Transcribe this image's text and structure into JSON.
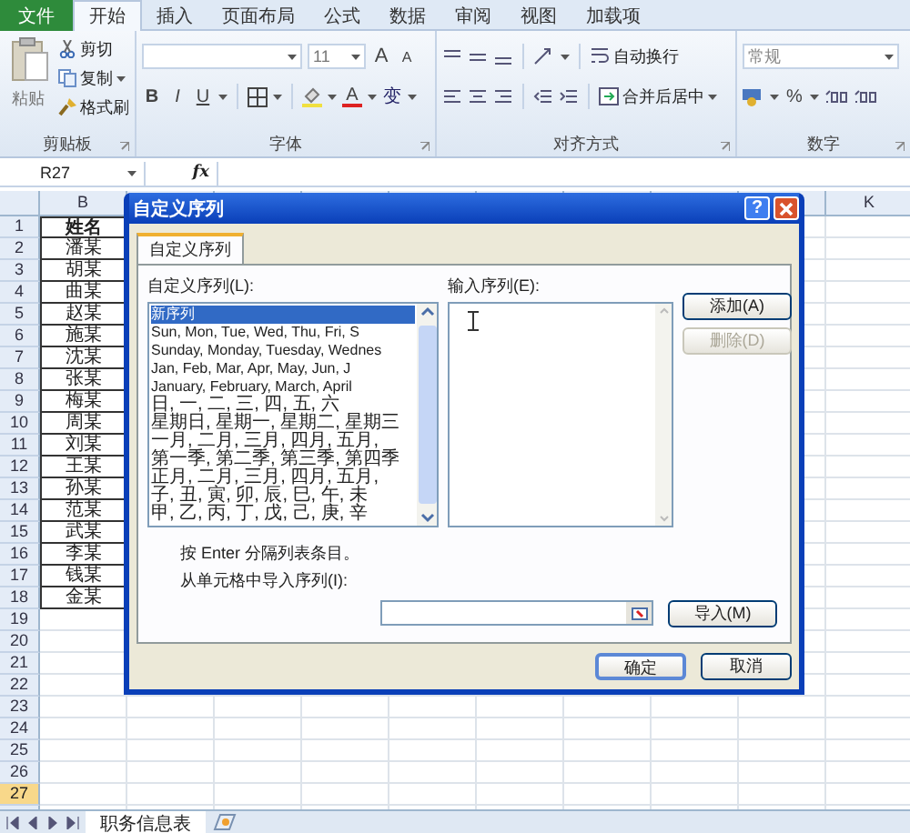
{
  "ribbon": {
    "tabs": [
      {
        "label": "文件",
        "kind": "file",
        "selected": false
      },
      {
        "label": "开始",
        "kind": "tab",
        "selected": true
      },
      {
        "label": "插入",
        "kind": "tab",
        "selected": false
      },
      {
        "label": "页面布局",
        "kind": "tab",
        "selected": false
      },
      {
        "label": "公式",
        "kind": "tab",
        "selected": false
      },
      {
        "label": "数据",
        "kind": "tab",
        "selected": false
      },
      {
        "label": "审阅",
        "kind": "tab",
        "selected": false
      },
      {
        "label": "视图",
        "kind": "tab",
        "selected": false
      },
      {
        "label": "加载项",
        "kind": "tab",
        "selected": false
      }
    ],
    "clipboard": {
      "label": "剪贴板",
      "paste": "粘贴",
      "cut": "剪切",
      "copy": "复制",
      "format_painter": "格式刷"
    },
    "font": {
      "label": "字体",
      "size": "11",
      "size_buttons": [
        "A",
        "A"
      ],
      "style_buttons": [
        "B",
        "I",
        "U"
      ],
      "color_button": "A",
      "phonetic_button": "变"
    },
    "alignment": {
      "label": "对齐方式",
      "wrap": "自动换行",
      "merge": "合并后居中"
    },
    "number": {
      "label": "数字",
      "format": "常规",
      "percent": "%"
    }
  },
  "formula_bar": {
    "name_box": "R27",
    "function_button": "fx"
  },
  "sheet": {
    "columns": [
      "B",
      "K"
    ],
    "rows": [
      {
        "number": "1",
        "name": "姓名",
        "selected": false
      },
      {
        "number": "2",
        "name": "潘某",
        "selected": false
      },
      {
        "number": "3",
        "name": "胡某",
        "selected": false
      },
      {
        "number": "4",
        "name": "曲某",
        "selected": false
      },
      {
        "number": "5",
        "name": "赵某",
        "selected": false
      },
      {
        "number": "6",
        "name": "施某",
        "selected": false
      },
      {
        "number": "7",
        "name": "沈某",
        "selected": false
      },
      {
        "number": "8",
        "name": "张某",
        "selected": false
      },
      {
        "number": "9",
        "name": "梅某",
        "selected": false
      },
      {
        "number": "10",
        "name": "周某",
        "selected": false
      },
      {
        "number": "11",
        "name": "刘某",
        "selected": false
      },
      {
        "number": "12",
        "name": "王某",
        "selected": false
      },
      {
        "number": "13",
        "name": "孙某",
        "selected": false
      },
      {
        "number": "14",
        "name": "范某",
        "selected": false
      },
      {
        "number": "15",
        "name": "武某",
        "selected": false
      },
      {
        "number": "16",
        "name": "李某",
        "selected": false
      },
      {
        "number": "17",
        "name": "钱某",
        "selected": false
      },
      {
        "number": "18",
        "name": "金某",
        "selected": false
      },
      {
        "number": "19",
        "selected": false
      },
      {
        "number": "20",
        "selected": false
      },
      {
        "number": "21",
        "selected": false
      },
      {
        "number": "22",
        "selected": false
      },
      {
        "number": "23",
        "selected": false
      },
      {
        "number": "24",
        "selected": false
      },
      {
        "number": "25",
        "selected": false
      },
      {
        "number": "26",
        "selected": false
      },
      {
        "number": "27",
        "selected": true
      }
    ]
  },
  "sheet_tabs": [
    {
      "label": "职务信息表",
      "selected": true
    }
  ],
  "dialog": {
    "title": "自定义序列",
    "help_button": "?",
    "tabs": [
      {
        "label": "自定义序列",
        "selected": true
      }
    ],
    "list_label": "自定义序列(L):",
    "list_items": [
      {
        "text": "新序列",
        "selected": true
      },
      {
        "text": "Sun, Mon, Tue, Wed, Thu, Fri, S",
        "selected": false
      },
      {
        "text": "Sunday, Monday, Tuesday, Wednes",
        "selected": false
      },
      {
        "text": "Jan, Feb, Mar, Apr, May, Jun, J",
        "selected": false
      },
      {
        "text": "January, February, March, April",
        "selected": false
      },
      {
        "text": "日, 一, 二, 三, 四, 五, 六",
        "selected": false
      },
      {
        "text": "星期日, 星期一, 星期二, 星期三",
        "selected": false
      },
      {
        "text": "一月, 二月, 三月, 四月, 五月,",
        "selected": false
      },
      {
        "text": "第一季, 第二季, 第三季, 第四季",
        "selected": false
      },
      {
        "text": "正月, 二月, 三月, 四月, 五月,",
        "selected": false
      },
      {
        "text": "子, 丑, 寅, 卯, 辰, 巳, 午, 未",
        "selected": false
      },
      {
        "text": "甲, 乙, 丙, 丁, 戊, 己, 庚, 辛",
        "selected": false
      }
    ],
    "entries_label": "输入序列(E):",
    "buttons": [
      {
        "label": "添加(A)",
        "disabled": false
      },
      {
        "label": "删除(D)",
        "disabled": true
      }
    ],
    "hint": "按 Enter 分隔列表条目。",
    "import_label": "从单元格中导入序列(I):",
    "import_button": "导入(M)",
    "footer_buttons": [
      "确定",
      "取消"
    ]
  }
}
